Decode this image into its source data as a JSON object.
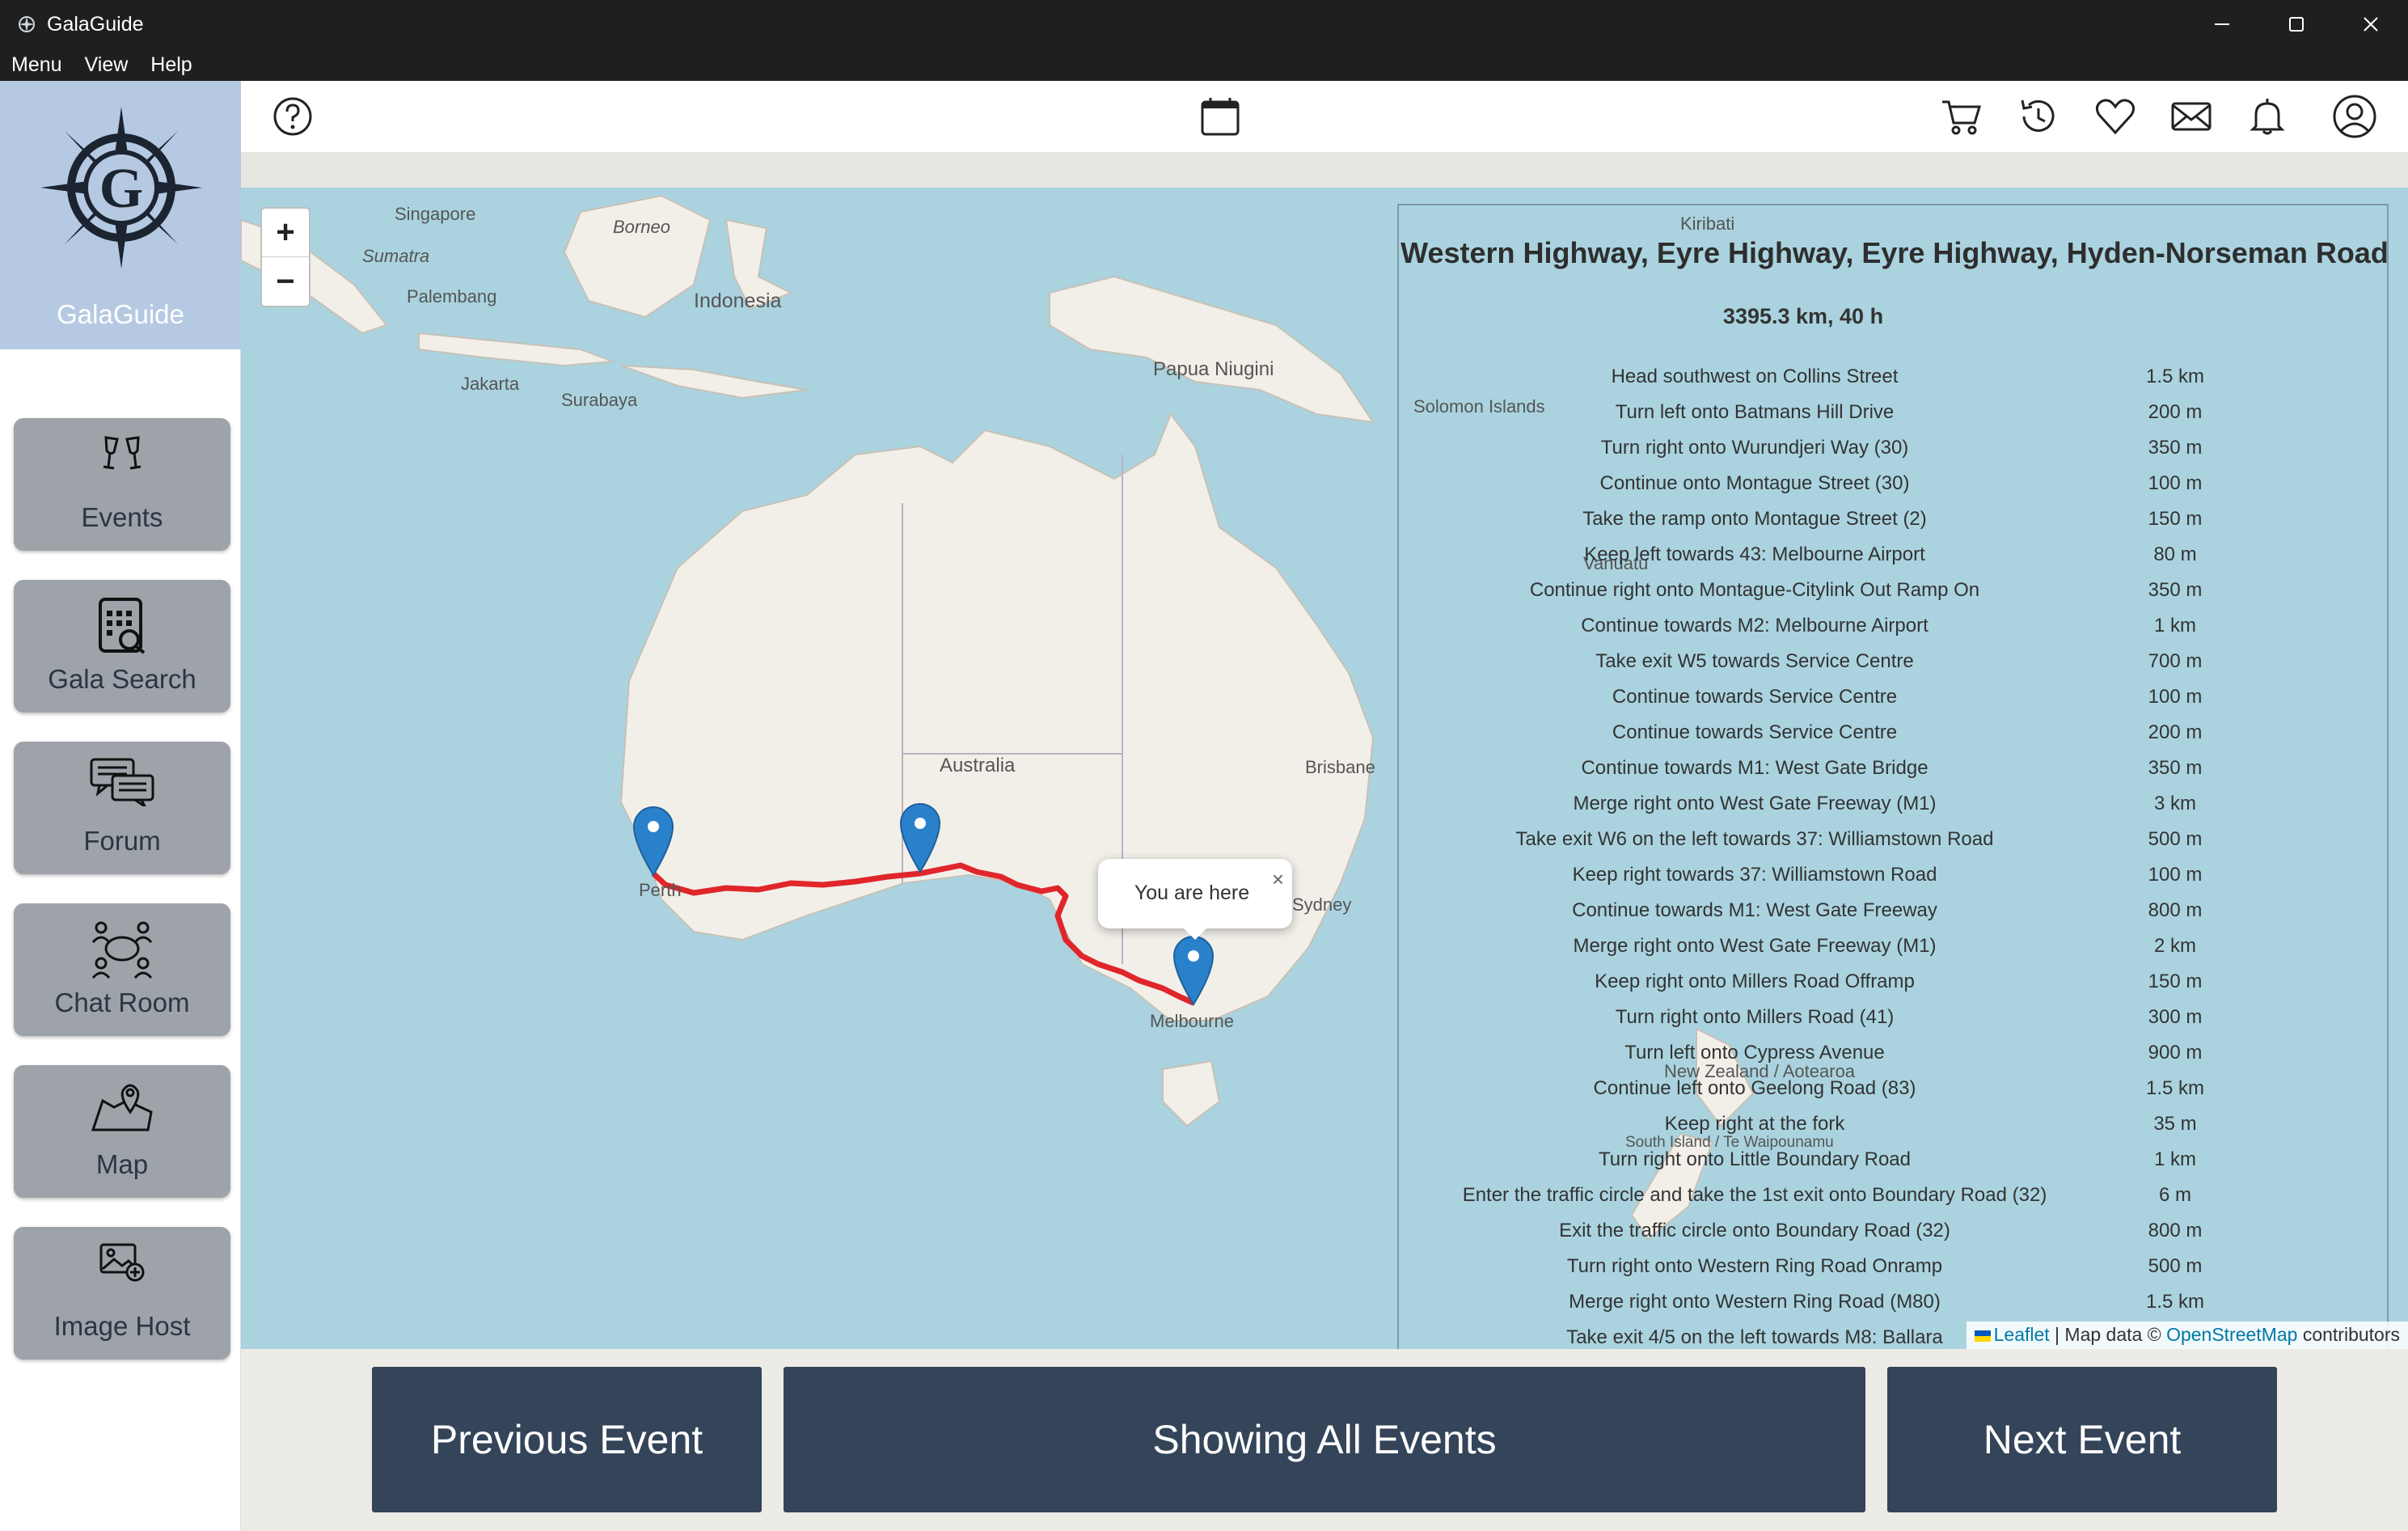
{
  "window": {
    "title": "GalaGuide",
    "controls": [
      "minimize",
      "maximize",
      "close"
    ]
  },
  "menubar": {
    "items": [
      "Menu",
      "View",
      "Help"
    ]
  },
  "brand": {
    "name": "GalaGuide"
  },
  "sidebar": {
    "items": [
      {
        "label": "Events",
        "icon": "champagne-glasses-icon"
      },
      {
        "label": "Gala Search",
        "icon": "search-calendar-icon"
      },
      {
        "label": "Forum",
        "icon": "chat-bubbles-icon"
      },
      {
        "label": "Chat Room",
        "icon": "group-chat-icon"
      },
      {
        "label": "Map",
        "icon": "map-pin-icon"
      },
      {
        "label": "Image Host",
        "icon": "image-upload-icon"
      }
    ]
  },
  "toolbar": {
    "left": [
      "help-icon"
    ],
    "center": [
      "calendar-icon"
    ],
    "right": [
      "cart-icon",
      "history-icon",
      "heart-icon",
      "mail-icon",
      "bell-icon",
      "account-icon"
    ]
  },
  "map": {
    "zoom_in": "+",
    "zoom_out": "−",
    "popup_text": "You are here",
    "popup_close": "×",
    "labels": [
      {
        "text": "Singapore"
      },
      {
        "text": "Borneo"
      },
      {
        "text": "Sumatra"
      },
      {
        "text": "Palembang"
      },
      {
        "text": "Indonesia"
      },
      {
        "text": "Jakarta"
      },
      {
        "text": "Surabaya"
      },
      {
        "text": "Papua Niugini"
      },
      {
        "text": "Kiribati"
      },
      {
        "text": "Solomon Islands"
      },
      {
        "text": "Vanuatu"
      },
      {
        "text": "Australia"
      },
      {
        "text": "Brisbane"
      },
      {
        "text": "Perth"
      },
      {
        "text": "Sydney"
      },
      {
        "text": "Melbourne"
      },
      {
        "text": "New Zealand / Aotearoa"
      },
      {
        "text": "South Island / Te Waipounamu"
      }
    ],
    "attribution": {
      "leaflet": "Leaflet",
      "sep": " | Map data © ",
      "osm": "OpenStreetMap",
      "suffix": " contributors"
    }
  },
  "route": {
    "title": "Western Highway, Eyre Highway, Eyre Highway, Hyden-Norseman Road",
    "summary": "3395.3 km, 40 h",
    "steps": [
      {
        "instruction": "Head southwest on Collins Street",
        "distance": "1.5 km"
      },
      {
        "instruction": "Turn left onto Batmans Hill Drive",
        "distance": "200 m"
      },
      {
        "instruction": "Turn right onto Wurundjeri Way (30)",
        "distance": "350 m"
      },
      {
        "instruction": "Continue onto Montague Street (30)",
        "distance": "100 m"
      },
      {
        "instruction": "Take the ramp onto Montague Street (2)",
        "distance": "150 m"
      },
      {
        "instruction": "Keep left towards 43: Melbourne Airport",
        "distance": "80 m"
      },
      {
        "instruction": "Continue right onto Montague-Citylink Out Ramp On",
        "distance": "350 m"
      },
      {
        "instruction": "Continue towards M2: Melbourne Airport",
        "distance": "1 km"
      },
      {
        "instruction": "Take exit W5 towards Service Centre",
        "distance": "700 m"
      },
      {
        "instruction": "Continue towards Service Centre",
        "distance": "100 m"
      },
      {
        "instruction": "Continue towards Service Centre",
        "distance": "200 m"
      },
      {
        "instruction": "Continue towards M1: West Gate Bridge",
        "distance": "350 m"
      },
      {
        "instruction": "Merge right onto West Gate Freeway (M1)",
        "distance": "3 km"
      },
      {
        "instruction": "Take exit W6 on the left towards 37: Williamstown Road",
        "distance": "500 m"
      },
      {
        "instruction": "Keep right towards 37: Williamstown Road",
        "distance": "100 m"
      },
      {
        "instruction": "Continue towards M1: West Gate Freeway",
        "distance": "800 m"
      },
      {
        "instruction": "Merge right onto West Gate Freeway (M1)",
        "distance": "2 km"
      },
      {
        "instruction": "Keep right onto Millers Road Offramp",
        "distance": "150 m"
      },
      {
        "instruction": "Turn right onto Millers Road (41)",
        "distance": "300 m"
      },
      {
        "instruction": "Turn left onto Cypress Avenue",
        "distance": "900 m"
      },
      {
        "instruction": "Continue left onto Geelong Road (83)",
        "distance": "1.5 km"
      },
      {
        "instruction": "Keep right at the fork",
        "distance": "35 m"
      },
      {
        "instruction": "Turn right onto Little Boundary Road",
        "distance": "1 km"
      },
      {
        "instruction": "Enter the traffic circle and take the 1st exit onto Boundary Road (32)",
        "distance": "6 m"
      },
      {
        "instruction": "Exit the traffic circle onto Boundary Road (32)",
        "distance": "800 m"
      },
      {
        "instruction": "Turn right onto Western Ring Road Onramp",
        "distance": "500 m"
      },
      {
        "instruction": "Merge right onto Western Ring Road (M80)",
        "distance": "1.5 km"
      },
      {
        "instruction": "Take exit 4/5 on the left towards M8: Ballara",
        "distance": ""
      }
    ]
  },
  "bottom": {
    "prev": "Previous Event",
    "center": "Showing All Events",
    "next": "Next Event"
  },
  "colors": {
    "titlebar": "#1f1f1f",
    "brand_bg": "#b5c9e2",
    "nav_button": "#9ea3a9",
    "bottom_button": "#344459",
    "map_water": "#aad3df",
    "map_land": "#f2efe9",
    "route": "#e0262b",
    "marker": "#2a81cb"
  }
}
